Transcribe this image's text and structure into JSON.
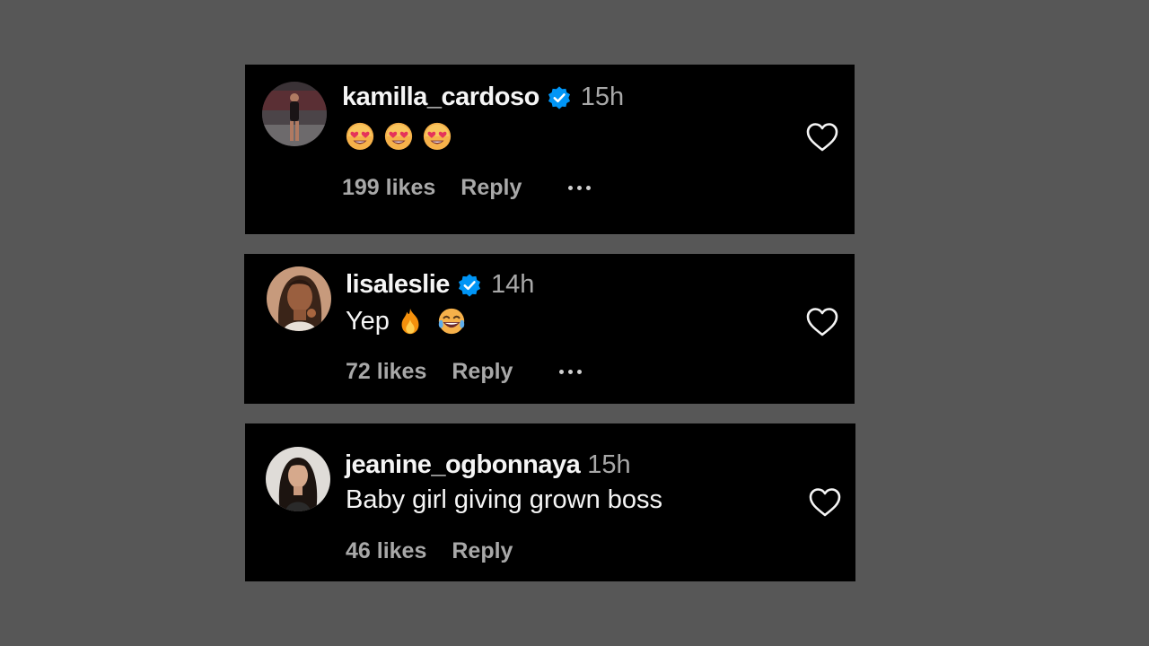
{
  "comments": [
    {
      "username": "kamilla_cardoso",
      "verified": true,
      "timestamp": "15h",
      "text": "",
      "emojis": [
        "smiling-face-with-heart-eyes",
        "smiling-face-with-heart-eyes",
        "smiling-face-with-heart-eyes"
      ],
      "likes": "199 likes",
      "reply_label": "Reply",
      "has_more_menu": true
    },
    {
      "username": "lisaleslie",
      "verified": true,
      "timestamp": "14h",
      "text": "Yep",
      "emojis": [
        "fire",
        "face-with-tears-of-joy"
      ],
      "likes": "72 likes",
      "reply_label": "Reply",
      "has_more_menu": true
    },
    {
      "username": "jeanine_ogbonnaya",
      "verified": false,
      "timestamp": "15h",
      "text": "Baby girl giving grown boss",
      "emojis": [],
      "likes": "46 likes",
      "reply_label": "Reply",
      "has_more_menu": false
    }
  ],
  "colors": {
    "page_background": "#575757",
    "card_background": "#000000",
    "primary_text": "#f5f5f5",
    "secondary_text": "#a8a8a8",
    "verified_badge": "#0095f6"
  },
  "icons": {
    "verified": "verified-badge-icon",
    "like": "heart-outline-icon",
    "more": "more-options-icon"
  }
}
